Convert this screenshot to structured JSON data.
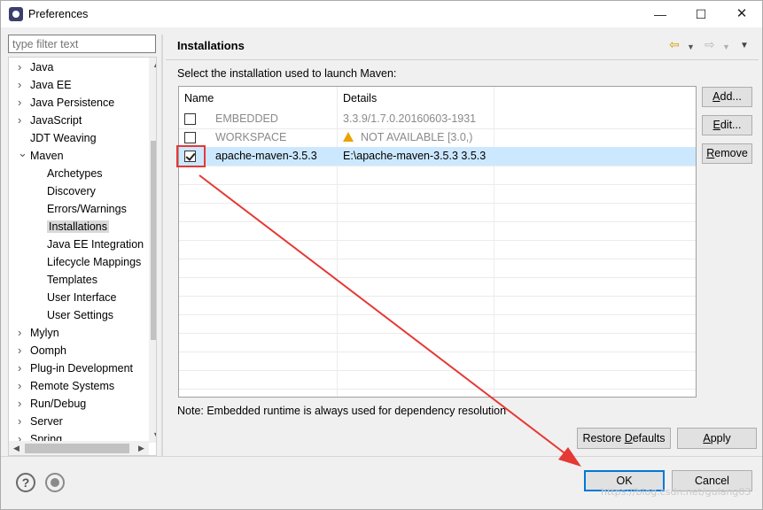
{
  "window": {
    "title": "Preferences",
    "minimize": "—",
    "maximize": "☐",
    "close": "✕"
  },
  "filter": {
    "placeholder": "type filter text"
  },
  "tree": {
    "items": [
      {
        "label": "Java",
        "depth": 0,
        "state": "collapsed"
      },
      {
        "label": "Java EE",
        "depth": 0,
        "state": "collapsed"
      },
      {
        "label": "Java Persistence",
        "depth": 0,
        "state": "collapsed"
      },
      {
        "label": "JavaScript",
        "depth": 0,
        "state": "collapsed"
      },
      {
        "label": "JDT Weaving",
        "depth": 0,
        "state": "leaf"
      },
      {
        "label": "Maven",
        "depth": 0,
        "state": "expanded"
      },
      {
        "label": "Archetypes",
        "depth": 1,
        "state": "leaf"
      },
      {
        "label": "Discovery",
        "depth": 1,
        "state": "leaf"
      },
      {
        "label": "Errors/Warnings",
        "depth": 1,
        "state": "leaf"
      },
      {
        "label": "Installations",
        "depth": 1,
        "state": "leaf",
        "selected": true
      },
      {
        "label": "Java EE Integration",
        "depth": 1,
        "state": "leaf"
      },
      {
        "label": "Lifecycle Mappings",
        "depth": 1,
        "state": "leaf"
      },
      {
        "label": "Templates",
        "depth": 1,
        "state": "leaf"
      },
      {
        "label": "User Interface",
        "depth": 1,
        "state": "leaf"
      },
      {
        "label": "User Settings",
        "depth": 1,
        "state": "leaf"
      },
      {
        "label": "Mylyn",
        "depth": 0,
        "state": "collapsed"
      },
      {
        "label": "Oomph",
        "depth": 0,
        "state": "collapsed"
      },
      {
        "label": "Plug-in Development",
        "depth": 0,
        "state": "collapsed"
      },
      {
        "label": "Remote Systems",
        "depth": 0,
        "state": "collapsed"
      },
      {
        "label": "Run/Debug",
        "depth": 0,
        "state": "collapsed"
      },
      {
        "label": "Server",
        "depth": 0,
        "state": "collapsed"
      },
      {
        "label": "Spring",
        "depth": 0,
        "state": "collapsed"
      }
    ]
  },
  "page": {
    "title": "Installations",
    "instruction": "Select the installation used to launch Maven:",
    "table": {
      "columns": [
        "Name",
        "Details"
      ],
      "rows": [
        {
          "checked": false,
          "name": "EMBEDDED",
          "details": "3.3.9/1.7.0.20160603-1931",
          "greyed": true,
          "warning": false
        },
        {
          "checked": false,
          "name": "WORKSPACE",
          "details": "NOT AVAILABLE [3.0,)",
          "greyed": true,
          "warning": true
        },
        {
          "checked": true,
          "name": "apache-maven-3.5.3",
          "details": "E:\\apache-maven-3.5.3 3.5.3",
          "greyed": false,
          "warning": false
        }
      ]
    },
    "buttons": {
      "add": {
        "pre": "",
        "key": "A",
        "post": "dd..."
      },
      "edit": {
        "pre": "",
        "key": "E",
        "post": "dit..."
      },
      "remove": {
        "pre": "",
        "key": "R",
        "post": "emove"
      }
    },
    "note": "Note: Embedded runtime is always used for dependency resolution",
    "restore": {
      "pre": "Restore ",
      "key": "D",
      "post": "efaults"
    },
    "apply": {
      "pre": "",
      "key": "A",
      "post": "pply"
    }
  },
  "footer": {
    "ok": "OK",
    "cancel": "Cancel",
    "watermark": "https://blog.csdn.net/gulang03"
  },
  "colors": {
    "accent": "#0078d7",
    "selection": "#cce8ff",
    "annotation": "#e53935",
    "warning": "#e8a400"
  },
  "icons": {
    "back": "arrow-left-icon",
    "forward": "arrow-right-icon",
    "help": "help-icon",
    "record": "record-icon"
  }
}
